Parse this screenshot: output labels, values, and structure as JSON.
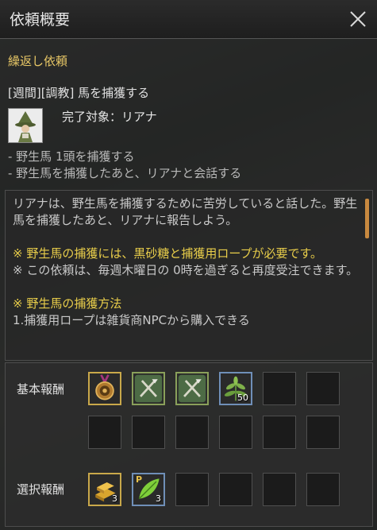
{
  "window": {
    "title": "依頼概要"
  },
  "quest": {
    "type": "繰返し依頼",
    "name": "[週間][調教] 馬を捕獲する",
    "complete_target": "完了対象：リアナ",
    "objectives": [
      "- 野生馬 1頭を捕獲する",
      "- 野生馬を捕獲したあと、リアナと会話する"
    ],
    "description": {
      "para1": "リアナは、野生馬を捕獲するために苦労していると話した。野生馬を捕獲したあと、リアナに報告しよう。",
      "note1": "※ 野生馬の捕獲には、黒砂糖と捕獲用ロープが必要です。",
      "note2": "※ この依頼は、毎週木曜日の 0時を過ぎると再度受注できます。",
      "method_title": "※ 野生馬の捕獲方法",
      "method_line1": "1.捕獲用ロープは雑貨商NPCから購入できる"
    }
  },
  "rewards": {
    "basic_label": "基本報酬",
    "selectable_label": "選択報酬",
    "basic_items": [
      {
        "icon": "medal-icon",
        "count": ""
      },
      {
        "icon": "crossed-tools-icon",
        "count": ""
      },
      {
        "icon": "crossed-tools-icon",
        "count": ""
      },
      {
        "icon": "herb-icon",
        "count": "50"
      }
    ],
    "selectable_items": [
      {
        "icon": "gold-bar-icon",
        "count": "3"
      },
      {
        "icon": "leaf-icon",
        "count": "3",
        "badge": "P"
      }
    ]
  },
  "colors": {
    "accent_yellow": "#e8cd4a",
    "scrollbar": "#c8893f"
  }
}
